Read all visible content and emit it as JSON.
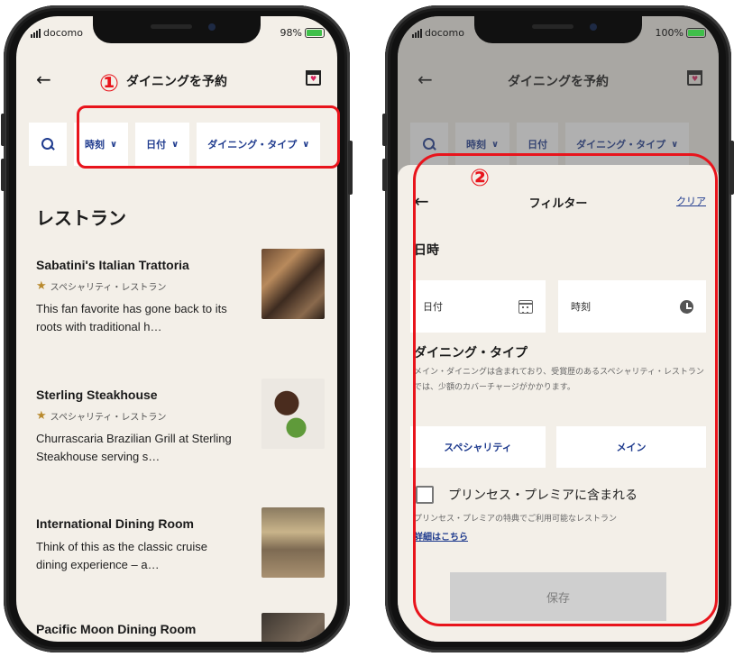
{
  "annotations": {
    "marker1": "①",
    "marker2": "②"
  },
  "colors": {
    "accent": "#1f3b8e",
    "annotation": "#e8141c",
    "background": "#f3efe8",
    "battery": "#3fbf4a"
  },
  "left_screen": {
    "status": {
      "carrier": "docomo",
      "battery": "98%"
    },
    "header": {
      "back_icon": "←",
      "title": "ダイニングを予約",
      "calendar_icon": "calendar-heart-icon"
    },
    "filters": {
      "search_icon": "search-icon",
      "time": "時刻",
      "date": "日付",
      "dining_type": "ダイニング・タイプ",
      "chevron": "∨"
    },
    "section_title": "レストラン",
    "restaurants": [
      {
        "name": "Sabatini's Italian Trattoria",
        "star": "★",
        "type": "スペシャリティ・レストラン",
        "description": "This fan favorite has gone back to its roots with traditional h…"
      },
      {
        "name": "Sterling Steakhouse",
        "star": "★",
        "type": "スペシャリティ・レストラン",
        "description": "Churrascaria Brazilian Grill at Sterling Steakhouse serving s…"
      },
      {
        "name": "International Dining Room",
        "description": "Think of this as the classic cruise dining experience – a…"
      },
      {
        "name": "Pacific Moon Dining Room"
      }
    ]
  },
  "right_screen": {
    "status": {
      "carrier": "docomo",
      "battery": "100%"
    },
    "header": {
      "back_icon": "←",
      "title": "ダイニングを予約"
    },
    "filters": {
      "time": "時刻",
      "date": "日付",
      "dining_type": "ダイニング・タイプ",
      "chevron": "∨"
    },
    "sheet": {
      "back_icon": "←",
      "title": "フィルター",
      "clear": "クリア",
      "datetime_label": "日時",
      "date_placeholder": "日付",
      "time_placeholder": "時刻",
      "dining_type_label": "ダイニング・タイプ",
      "dining_type_desc": "メイン・ダイニングは含まれており、受賞歴のあるスペシャリティ・レストランでは、少額のカバーチャージがかかります。",
      "btn_specialty": "スペシャリティ",
      "btn_main": "メイン",
      "premier_label": "プリンセス・プレミアに含まれる",
      "premier_desc": "プリンセス・プレミアの特典でご利用可能なレストラン",
      "details_link": "詳細はこちら",
      "save": "保存"
    }
  }
}
